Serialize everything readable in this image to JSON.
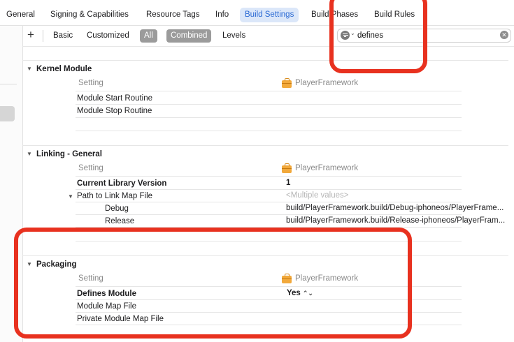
{
  "tabs": [
    {
      "label": "General"
    },
    {
      "label": "Signing & Capabilities"
    },
    {
      "label": "Resource Tags"
    },
    {
      "label": "Info"
    },
    {
      "label": "Build Settings"
    },
    {
      "label": "Build Phases"
    },
    {
      "label": "Build Rules"
    }
  ],
  "filters": {
    "basic": "Basic",
    "customized": "Customized",
    "all": "All",
    "combined": "Combined",
    "levels": "Levels",
    "search_value": "defines"
  },
  "sections": [
    {
      "title": "Kernel Module",
      "setting_header": "Setting",
      "target": "PlayerFramework",
      "rows": [
        {
          "name": "Module Start Routine",
          "value": ""
        },
        {
          "name": "Module Stop Routine",
          "value": ""
        }
      ]
    },
    {
      "title": "Linking - General",
      "setting_header": "Setting",
      "target": "PlayerFramework",
      "rows": [
        {
          "name": "Current Library Version",
          "value": "1"
        },
        {
          "name": "Path to Link Map File",
          "value": "<Multiple values>"
        },
        {
          "name": "Debug",
          "value": "build/PlayerFramework.build/Debug-iphoneos/PlayerFrame..."
        },
        {
          "name": "Release",
          "value": "build/PlayerFramework.build/Release-iphoneos/PlayerFram..."
        }
      ]
    },
    {
      "title": "Packaging",
      "setting_header": "Setting",
      "target": "PlayerFramework",
      "rows": [
        {
          "name": "Defines Module",
          "value": "Yes"
        },
        {
          "name": "Module Map File",
          "value": ""
        },
        {
          "name": "Private Module Map File",
          "value": ""
        }
      ]
    }
  ],
  "colors": {
    "accent": "#2a6ad4",
    "active_tab_bg": "#dbe7f9",
    "annotation_red": "#e8311f",
    "target_icon": "#f2a93b"
  },
  "icons": {
    "add": "plus-icon",
    "filter": "filter-icon",
    "clear": "clear-search-icon",
    "target": "framework-target-icon",
    "disclosure": "chevron-down-icon"
  }
}
